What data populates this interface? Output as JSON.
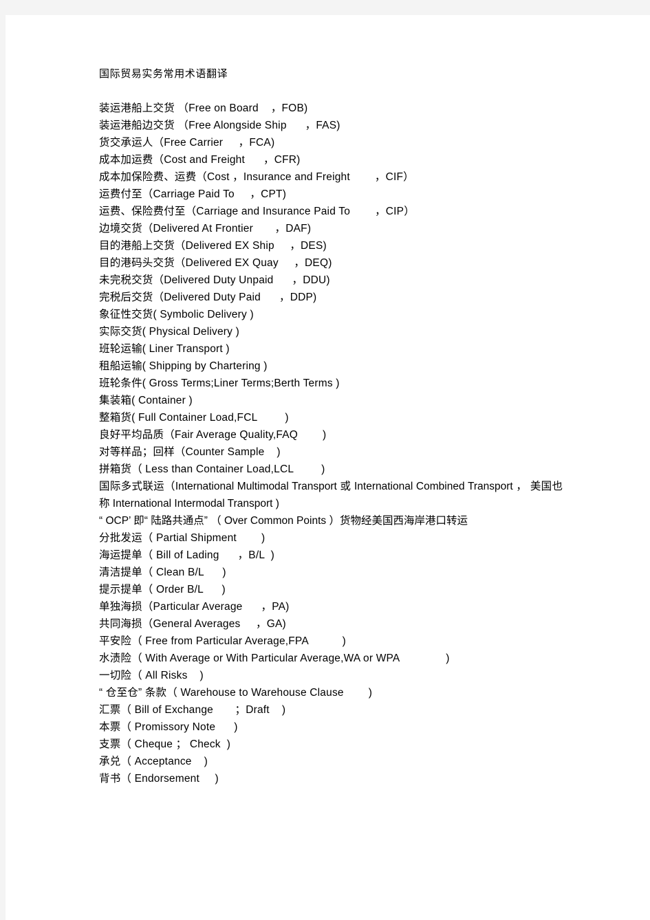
{
  "document": {
    "title": "国际贸易实务常用术语翻译",
    "page_background": "#ffffff",
    "canvas_background": "#f4f4f4",
    "text_color": "#000000",
    "lines": [
      "装运港船上交货 （Free on Board    ，FOB)",
      "装运港船边交货 （Free Alongside Ship      ，FAS)",
      "货交承运人（Free Carrier     ，FCA)",
      "成本加运费（Cost and Freight      ，CFR)",
      "成本加保险费、运费（Cost ，Insurance and Freight        ，CIF）",
      "运费付至（Carriage Paid To     ，CPT)",
      "运费、保险费付至（Carriage and Insurance Paid To        ，CIP）",
      "边境交货（Delivered At Frontier       ，DAF)",
      "目的港船上交货（Delivered EX Ship     ，DES)",
      "目的港码头交货（Delivered EX Quay     ，DEQ)",
      "未完税交货（Delivered Duty Unpaid      ，DDU)",
      "完税后交货（Delivered Duty Paid      ，DDP)",
      "象征性交货( Symbolic Delivery )",
      "实际交货( Physical Delivery )",
      "班轮运输( Liner Transport )",
      "租船运输( Shipping by Chartering )",
      "班轮条件( Gross Terms;Liner Terms;Berth Terms )",
      "集装箱( Container )",
      "整箱货( Full Container Load,FCL         )",
      "良好平均品质（Fair Average Quality,FAQ        )",
      "对等样品；回样（Counter Sample    )",
      "拼箱货（ Less than Container Load,LCL         )"
    ],
    "paragraph_multimodal": "国际多式联运（International Multimodal Transport 或 International Combined Transport ， 美国也称 International Intermodal Transport        )",
    "paragraph_ocp": "“ OCP’ 即“ 陆路共通点” （ Over Common Points     ）货物经美国西海岸港口转运",
    "lines_tail": [
      "分批发运（ Partial Shipment        )",
      "海运提单（ Bill of Lading      ，B/L  )",
      "清洁提单（ Clean B/L      )",
      "提示提单（ Order B/L      )",
      "单独海损（Particular Average      ，PA)",
      "共同海损（General Averages     ，GA)",
      "平安险（ Free from Particular Average,FPA           )",
      "水渍险（ With Average or With Particular Average,WA or WPA               )",
      "一切险（ All Risks    )",
      "“ 仓至仓” 条款（ Warehouse to Warehouse Clause        )",
      "汇票（ Bill of Exchange       ；Draft    )",
      "本票（ Promissory Note      )",
      "支票（ Cheque ； Check  )",
      "承兑（ Acceptance    )",
      "背书（ Endorsement     )"
    ]
  }
}
